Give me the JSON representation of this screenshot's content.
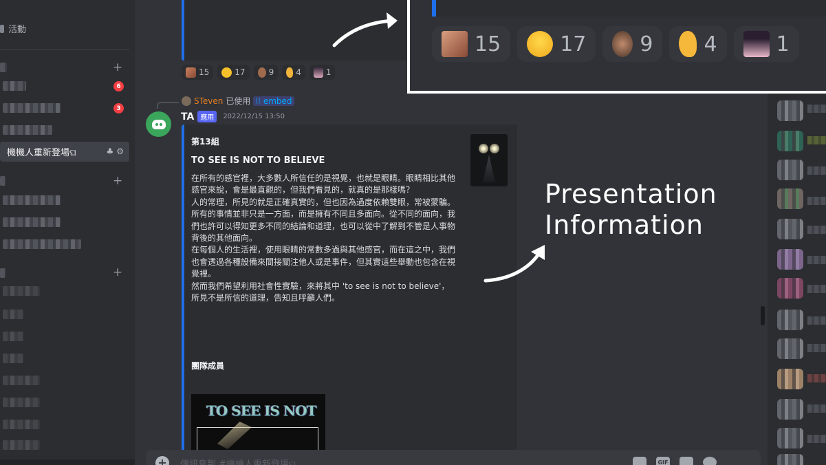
{
  "sidebar": {
    "activity_label": "活動",
    "badges": [
      "6",
      "3"
    ],
    "active_channel": "機機人重新登場ଘ"
  },
  "previous_message": {
    "reactions": [
      {
        "emoji": "face-photo-emoji",
        "count": "15"
      },
      {
        "emoji": "grinning-face-emoji",
        "count": "17"
      },
      {
        "emoji": "man-face-emoji",
        "count": "9"
      },
      {
        "emoji": "ear-emoji",
        "count": "4"
      },
      {
        "emoji": "anime-girl-emoji",
        "count": "1"
      }
    ]
  },
  "message": {
    "reply_user": "STeven",
    "reply_used": "已使用",
    "reply_command": "embed",
    "author": "TA",
    "app_tag": "應用",
    "timestamp": "2022/12/15 13:50",
    "embed": {
      "group": "第13組",
      "title": "TO SEE IS NOT TO BELIEVE",
      "description": "在所有的感官裡，大多數人所信任的是視覺，也就是眼睛。眼睛相比其他感官來說，會是最直觀的，但我們看見的，就真的是那樣嗎？\n人的常理，所見的就是正確真實的，但也因為過度依賴雙眼，常被蒙騙。\n所有的事情並非只是一方面，而是擁有不同且多面向。從不同的面向，我們也許可以得知更多不同的結論和道理，也可以從中了解到不管是人事物背後的其他面向。\n在每個人的生活裡，使用眼睛的常數多過與其他感官，而在這之中，我們也會透過各種設備來間接關注他人或是事件，但其實這些舉動也包含在視覺裡。\n然而我們希望利用社會性實驗，來將其中 'to see is not to believe'，所見不是所信的道理，告知且呼籲人們。",
      "field_title": "團隊成員",
      "image_text": "TO SEE IS NOT",
      "accent_color": "#1f6feb"
    }
  },
  "input": {
    "placeholder": "傳訊息到 #機機人重新登場ଘ",
    "gif_label": "GIF"
  },
  "zoom": {
    "reactions": [
      {
        "emoji": "face-photo-emoji",
        "count": "15"
      },
      {
        "emoji": "grinning-face-emoji",
        "count": "17"
      },
      {
        "emoji": "man-face-emoji",
        "count": "9"
      },
      {
        "emoji": "ear-emoji",
        "count": "4"
      },
      {
        "emoji": "anime-girl-emoji",
        "count": "1"
      }
    ]
  },
  "annotation": {
    "label": "Presentation\nInformation"
  }
}
